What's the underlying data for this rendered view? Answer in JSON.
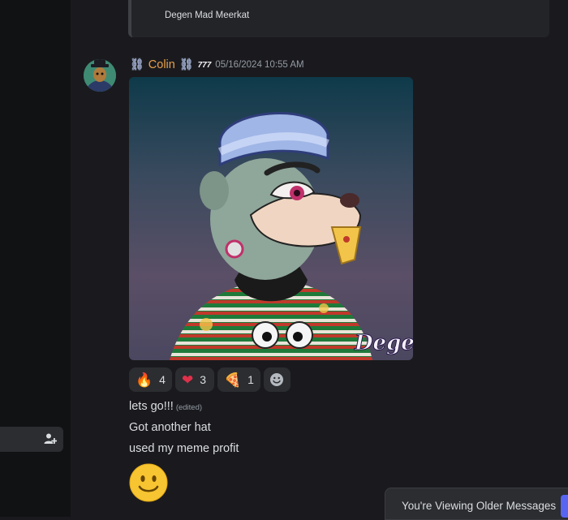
{
  "embed": {
    "title": "Degen Mad Meerkat"
  },
  "message": {
    "chain_left": "⛓",
    "username": "Colin",
    "chain_right": "⛓",
    "tag": "777",
    "timestamp": "05/16/2024 10:55 AM",
    "image_watermark": "Degen",
    "reactions": [
      {
        "emoji": "🔥",
        "count": "4",
        "icon": "fire-icon"
      },
      {
        "emoji": "❤",
        "count": "3",
        "icon": "heart-icon"
      },
      {
        "emoji": "🍕",
        "count": "1",
        "icon": "pizza-icon"
      }
    ],
    "add_reaction_icon": "smiley-add-icon",
    "lines": [
      "lets go!!!",
      "Got another hat",
      "used my meme profit"
    ],
    "edited_label": "(edited)",
    "big_emoji_icon": "slightly-smiling-face-icon"
  },
  "sidebar": {
    "row_icon": "add-member-icon"
  },
  "older_banner": {
    "text": "You're Viewing Older Messages"
  },
  "colors": {
    "username": "#e6a14b",
    "accent": "#5865f2",
    "background": "#1a1a1e"
  }
}
